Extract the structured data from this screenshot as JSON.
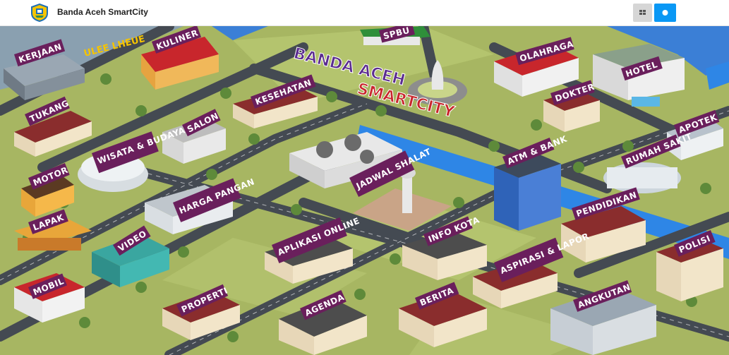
{
  "app": {
    "title": "Banda Aceh SmartCity"
  },
  "header": {
    "grid_icon": "grid-icon",
    "map_icon": "circle-dot-icon",
    "active_color": "#0a98f5"
  },
  "map": {
    "banner_line1": "BANDA ACEH",
    "banner_line2": "SMARTCITY",
    "district": "ULEE LHEUE",
    "buildings": {
      "kerjaan": "KERJAAN",
      "kuliner": "KULINER",
      "spbu": "SPBU",
      "olahraga": "OLAHRAGA",
      "hotel": "HOTEL",
      "tukang": "TUKANG",
      "kesehatan": "KESEHATAN",
      "dokter": "DOKTER",
      "salon": "SALON",
      "apotek": "APOTEK",
      "wisata_budaya": "WISATA & BUDAYA",
      "rumah_sakit": "RUMAH SAKIT",
      "motor": "MOTOR",
      "jadwal_shalat": "JADWAL SHALAT",
      "atm_bank": "ATM & BANK",
      "harga_pangan": "HARGA PANGAN",
      "pendidikan": "PENDIDIKAN",
      "lapak": "LAPAK",
      "video": "VIDEO",
      "aplikasi_online": "APLIKASI ONLINE",
      "info_kota": "INFO KOTA",
      "polisi": "POLISI",
      "aspirasi_lapor": "ASPIRASI & LAPOR",
      "mobil": "MOBIL",
      "properti": "PROPERTI",
      "berita": "BERITA",
      "agenda": "AGENDA",
      "angkutan": "ANGKUTAN"
    }
  }
}
